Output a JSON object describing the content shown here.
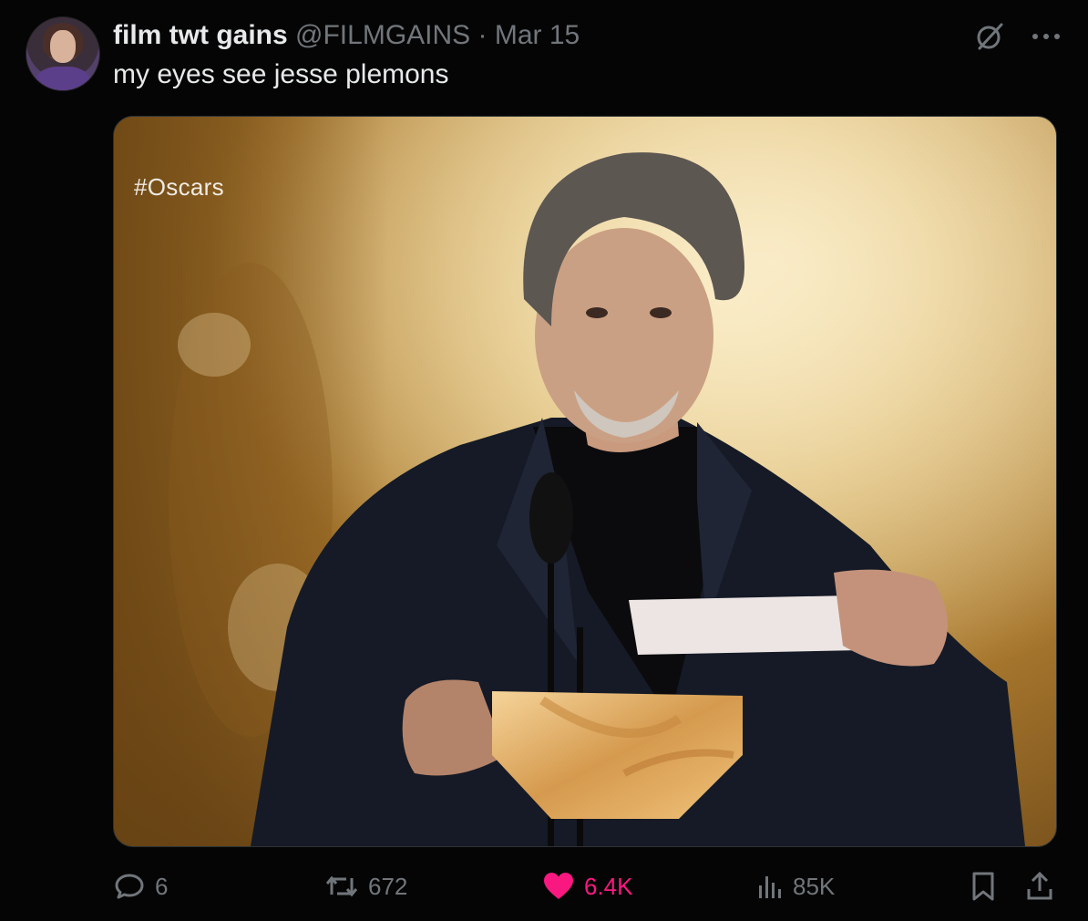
{
  "post": {
    "display_name": "film twt gains",
    "handle": "@FILMGAINS",
    "separator": "·",
    "date": "Mar 15",
    "text": "my eyes see jesse plemons",
    "avatar_icon": "user-avatar",
    "top_icons": [
      "grok-icon",
      "more-icon"
    ]
  },
  "media": {
    "overlay_text": "#Oscars",
    "description_icon": "photo"
  },
  "actions": {
    "replies": "6",
    "reposts": "672",
    "likes": "6.4K",
    "views": "85K",
    "icons": [
      "reply-icon",
      "repost-icon",
      "like-icon",
      "views-icon",
      "bookmark-icon",
      "share-icon"
    ]
  },
  "colors": {
    "background": "#000000",
    "text_primary": "#e7e9ea",
    "text_secondary": "#71767b",
    "like_pink": "#f91880",
    "border": "#2f3336"
  }
}
